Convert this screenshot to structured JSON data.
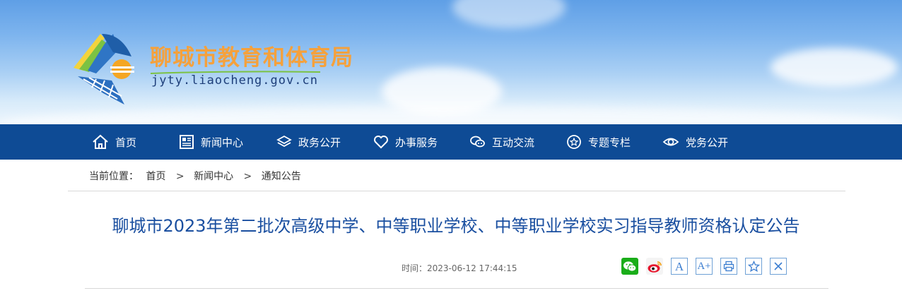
{
  "header": {
    "site_title": "聊城市教育和体育局",
    "site_url": "jyty.liaocheng.gov.cn"
  },
  "nav": {
    "items": [
      {
        "label": "首页",
        "icon": "home-icon"
      },
      {
        "label": "新闻中心",
        "icon": "newspaper-icon"
      },
      {
        "label": "政务公开",
        "icon": "layers-icon"
      },
      {
        "label": "办事服务",
        "icon": "heart-icon"
      },
      {
        "label": "互动交流",
        "icon": "chat-icon"
      },
      {
        "label": "专题专栏",
        "icon": "star-circle-icon"
      },
      {
        "label": "党务公开",
        "icon": "eye-icon"
      }
    ]
  },
  "breadcrumb": {
    "prefix": "当前位置：",
    "items": [
      "首页",
      "新闻中心",
      "通知公告"
    ],
    "separator": ">"
  },
  "article": {
    "title": "聊城市2023年第二批次高级中学、中等职业学校、中等职业学校实习指导教师资格认定公告",
    "time_label": "时间：2023-06-12 17:44:15"
  },
  "share_tools": {
    "font_small_label": "A",
    "font_large_label": "A+",
    "icons": [
      "wechat-icon",
      "weibo-icon",
      "font-decrease-icon",
      "font-increase-icon",
      "print-icon",
      "favorite-icon",
      "close-icon"
    ]
  },
  "colors": {
    "nav_bg": "#0e4b95",
    "title_orange": "#f5a13c",
    "article_title_blue": "#1a4fa0",
    "wechat_green": "#1aad19",
    "tool_border": "#6fa1d6"
  }
}
